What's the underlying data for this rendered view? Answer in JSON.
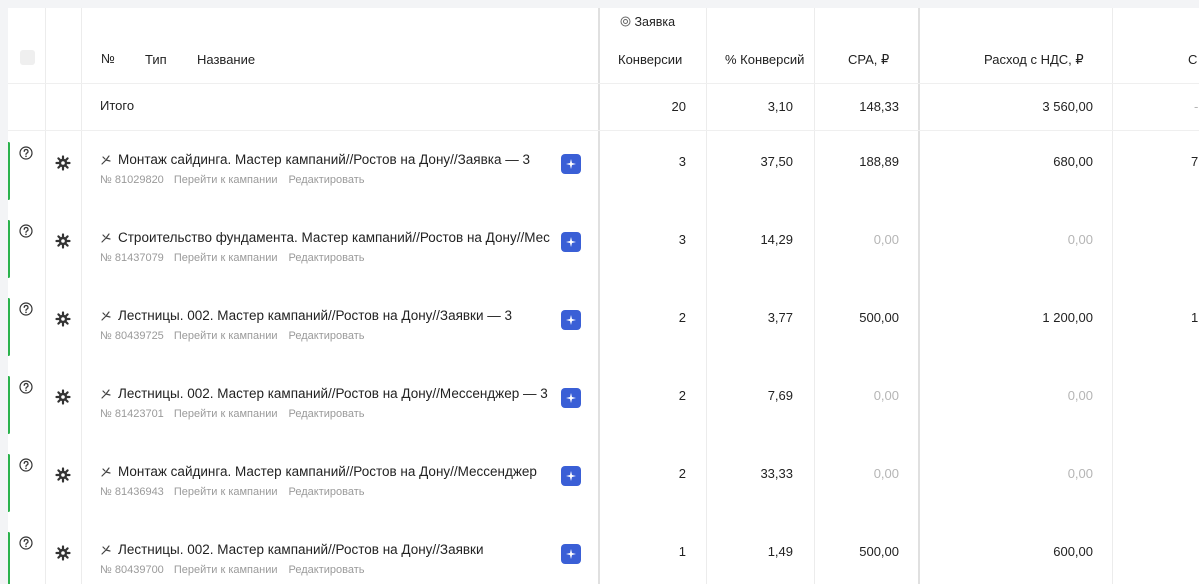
{
  "header": {
    "group_label": "Заявка",
    "col_no": "№",
    "col_type": "Тип",
    "col_name": "Название",
    "col_conversions": "Конверсии",
    "col_conv_pct": "% Конверсий",
    "col_cpa": "CPA, ₽",
    "col_spend": "Расход с НДС, ₽",
    "col_next_partial": "C"
  },
  "total": {
    "label": "Итого",
    "conversions": "20",
    "conv_pct": "3,10",
    "cpa": "148,33",
    "spend": "3 560,00",
    "next_partial": "-"
  },
  "links": {
    "goto": "Перейти к кампании",
    "edit": "Редактировать"
  },
  "rows": [
    {
      "title": "Монтаж сайдинга. Мастер кампаний//Ростов на Дону//Заявка — 3",
      "id": "№ 81029820",
      "conversions": "3",
      "conv_pct": "37,50",
      "cpa": "188,89",
      "spend": "680,00",
      "next_partial": "7",
      "muted": false
    },
    {
      "title": "Строительство фундамента. Мастер кампаний//Ростов на Дону//Мес",
      "id": "№ 81437079",
      "conversions": "3",
      "conv_pct": "14,29",
      "cpa": "0,00",
      "spend": "0,00",
      "next_partial": "",
      "muted": true
    },
    {
      "title": "Лестницы. 002. Мастер кампаний//Ростов на Дону//Заявки  — 3",
      "id": "№ 80439725",
      "conversions": "2",
      "conv_pct": "3,77",
      "cpa": "500,00",
      "spend": "1 200,00",
      "next_partial": "1",
      "muted": false
    },
    {
      "title": "Лестницы. 002. Мастер кампаний//Ростов на Дону//Мессенджер — 3",
      "id": "№ 81423701",
      "conversions": "2",
      "conv_pct": "7,69",
      "cpa": "0,00",
      "spend": "0,00",
      "next_partial": "",
      "muted": true
    },
    {
      "title": "Монтаж сайдинга. Мастер кампаний//Ростов на Дону//Мессенджер",
      "id": "№ 81436943",
      "conversions": "2",
      "conv_pct": "33,33",
      "cpa": "0,00",
      "spend": "0,00",
      "next_partial": "",
      "muted": true
    },
    {
      "title": "Лестницы. 002. Мастер кампаний//Ростов на Дону//Заявки",
      "id": "№ 80439700",
      "conversions": "1",
      "conv_pct": "1,49",
      "cpa": "500,00",
      "spend": "600,00",
      "next_partial": "",
      "muted": false
    }
  ],
  "icons": {
    "help": "question-circle-icon",
    "settings": "gear-icon",
    "type": "master-campaign-icon",
    "badge": "sparkle-icon",
    "goal": "target-icon"
  },
  "colors": {
    "status_bar": "#2bb24c",
    "badge": "#3a5fd6",
    "muted_text": "#b5b5b5"
  }
}
